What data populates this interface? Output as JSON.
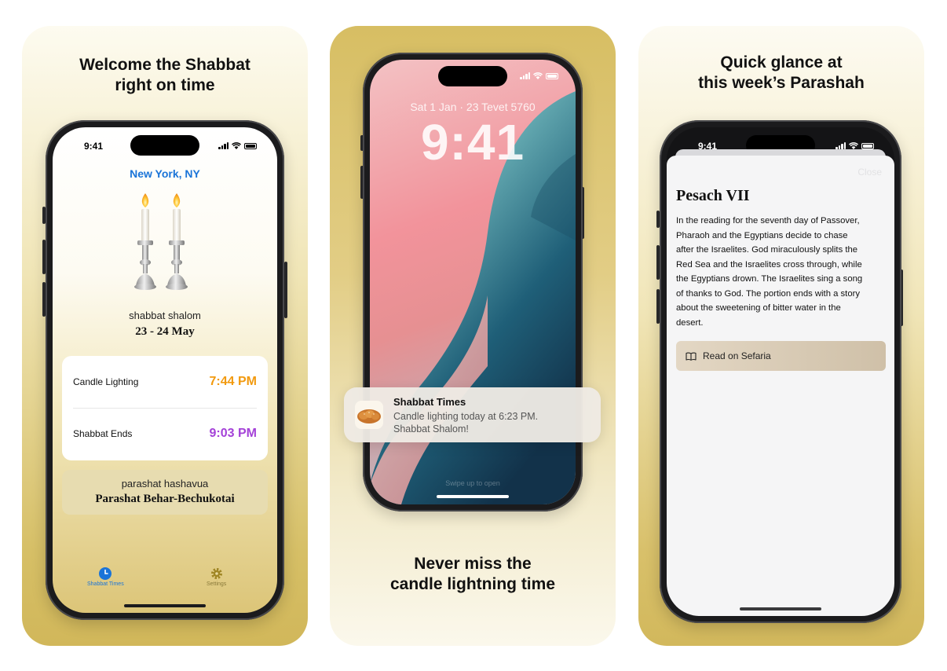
{
  "panel1": {
    "headline": [
      "Welcome the Shabbat",
      "right on time"
    ],
    "status_time": "9:41",
    "location": "New York, NY",
    "greeting": "shabbat shalom",
    "date_range": "23 - 24 May",
    "times": [
      {
        "label": "Candle Lighting",
        "value": "7:44 PM",
        "color": "#f29a0f"
      },
      {
        "label": "Shabbat Ends",
        "value": "9:03 PM",
        "color": "#a442d8"
      }
    ],
    "parasha_kicker": "parashat hashavua",
    "parasha_name": "Parashat Behar-Bechukotai",
    "tabs": [
      {
        "label": "Shabbat Times",
        "icon": "clock-icon",
        "active": true
      },
      {
        "label": "Settings",
        "icon": "gear-icon",
        "active": false
      }
    ]
  },
  "panel2": {
    "lock_date": "Sat 1 Jan · 23 Tevet 5760",
    "lock_time": "9:41",
    "notification": {
      "app": "Shabbat Times",
      "body": [
        "Candle lighting today at 6:23 PM.",
        "Shabbat Shalom!"
      ],
      "icon": "challah-icon"
    },
    "swipe_hint": "Swipe up to open",
    "headline": [
      "Never miss the",
      "candle lightning time"
    ]
  },
  "panel3": {
    "headline": [
      "Quick glance at",
      "this week’s Parashah"
    ],
    "status_time": "9:41",
    "close_label": "Close",
    "portion_title": "Pesach VII",
    "portion_text": [
      "In the reading for the seventh day of Passover,",
      "Pharaoh and the Egyptians decide to chase",
      "after the Israelites. God miraculously splits the",
      "Red Sea and the Israelites cross through, while",
      "the Egyptians drown. The Israelites sing a song",
      "of thanks to God. The portion ends with a story",
      "about the sweetening of bitter water in the",
      "desert."
    ],
    "read_button": "Read on Sefaria",
    "read_icon": "book-icon"
  }
}
